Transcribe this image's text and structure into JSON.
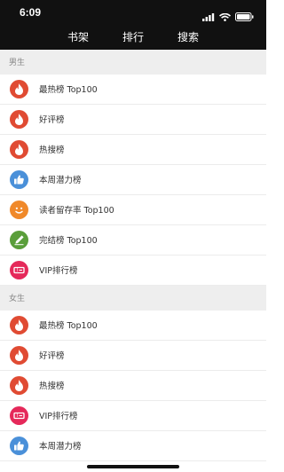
{
  "status_bar": {
    "time": "6:09",
    "icons": [
      "signal-icon",
      "wifi-icon",
      "battery-icon"
    ]
  },
  "nav": {
    "tabs": [
      {
        "label": "书架"
      },
      {
        "label": "排行"
      },
      {
        "label": "搜索"
      }
    ]
  },
  "sections": [
    {
      "title": "男生",
      "items": [
        {
          "label": "最热榜 Top100",
          "icon": "flame-icon",
          "color": "#e04b33"
        },
        {
          "label": "好评榜",
          "icon": "flame-icon",
          "color": "#e04b33"
        },
        {
          "label": "热搜榜",
          "icon": "flame-icon",
          "color": "#e04b33"
        },
        {
          "label": "本周潜力榜",
          "icon": "thumbs-up-icon",
          "color": "#4a90d9"
        },
        {
          "label": "读者留存率 Top100",
          "icon": "smile-icon",
          "color": "#f0892a"
        },
        {
          "label": "完结榜 Top100",
          "icon": "pen-icon",
          "color": "#5a9e3a"
        },
        {
          "label": "VIP排行榜",
          "icon": "ticket-icon",
          "color": "#e5295a"
        }
      ]
    },
    {
      "title": "女生",
      "items": [
        {
          "label": "最热榜 Top100",
          "icon": "flame-icon",
          "color": "#e04b33"
        },
        {
          "label": "好评榜",
          "icon": "flame-icon",
          "color": "#e04b33"
        },
        {
          "label": "热搜榜",
          "icon": "flame-icon",
          "color": "#e04b33"
        },
        {
          "label": "VIP排行榜",
          "icon": "ticket-icon",
          "color": "#e5295a"
        },
        {
          "label": "本周潜力榜",
          "icon": "thumbs-up-icon",
          "color": "#4a90d9"
        }
      ]
    }
  ]
}
